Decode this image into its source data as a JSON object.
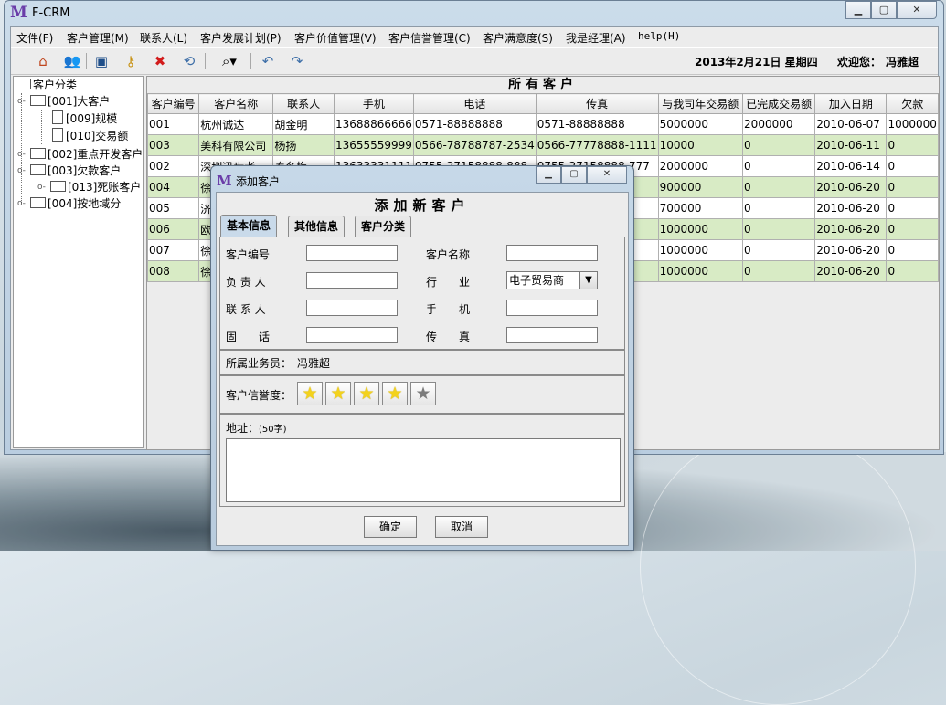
{
  "window": {
    "title": "F-CRM",
    "logo_letter": "M",
    "controls": {
      "minimize": "▁",
      "maximize": "▢",
      "close": "✕"
    }
  },
  "menu": [
    "文件(F)",
    "客户管理(M)",
    "联系人(L)",
    "客户发展计划(P)",
    "客户价值管理(V)",
    "客户信誉管理(C)",
    "客户满意度(S)",
    "我是经理(A)",
    "help(H)"
  ],
  "toolbar": {
    "icons": [
      "home-icon",
      "users-icon",
      "save-icon",
      "key-icon",
      "delete-icon",
      "refresh-icon",
      "binoculars-icon",
      "undo-icon",
      "redo-icon"
    ],
    "date": "2013年2月21日  星期四",
    "welcome_label": "欢迎您：",
    "user": "冯雅超"
  },
  "tree": {
    "root": "客户分类",
    "nodes": [
      {
        "label": "[001]大客户",
        "children": [
          "[009]规模",
          "[010]交易额"
        ]
      },
      {
        "label": "[002]重点开发客户",
        "children": []
      },
      {
        "label": "[003]欠款客户",
        "children": [
          "[013]死账客户"
        ]
      },
      {
        "label": "[004]按地域分",
        "children": []
      }
    ]
  },
  "customer_table": {
    "title": "所有客户",
    "columns": [
      "客户编号",
      "客户名称",
      "联系人",
      "手机",
      "电话",
      "传真",
      "与我司年交易额",
      "已完成交易额",
      "加入日期",
      "欠款"
    ],
    "rows": [
      [
        "001",
        "杭州诚达",
        "胡金明",
        "13688866666",
        "0571-88888888",
        "0571-88888888",
        "5000000",
        "2000000",
        "2010-06-07",
        "1000000"
      ],
      [
        "003",
        "美科有限公司",
        "杨扬",
        "13655559999",
        "0566-78788787-2534",
        "0566-77778888-1111",
        "10000",
        "0",
        "2010-06-11",
        "0"
      ],
      [
        "002",
        "深圳迅步者",
        "秦冬梅",
        "13633331111",
        "0755-27158888-888",
        "0755-27158888-777",
        "2000000",
        "0",
        "2010-06-14",
        "0"
      ],
      [
        "004",
        "徐",
        "",
        "",
        "",
        "",
        "900000",
        "0",
        "2010-06-20",
        "0"
      ],
      [
        "005",
        "济",
        "",
        "",
        "",
        "",
        "700000",
        "0",
        "2010-06-20",
        "0"
      ],
      [
        "006",
        "欧",
        "",
        "",
        "",
        "",
        "1000000",
        "0",
        "2010-06-20",
        "0"
      ],
      [
        "007",
        "徐",
        "",
        "",
        "",
        "",
        "1000000",
        "0",
        "2010-06-20",
        "0"
      ],
      [
        "008",
        "徐",
        "",
        "",
        "",
        "",
        "1000000",
        "0",
        "2010-06-20",
        "0"
      ]
    ]
  },
  "dialog": {
    "title": "添加客户",
    "heading": "添加新客户",
    "tabs": [
      "基本信息",
      "其他信息",
      "客户分类"
    ],
    "fields": {
      "customer_id": {
        "label": "客户编号",
        "value": ""
      },
      "customer_name": {
        "label": "客户名称",
        "value": ""
      },
      "manager": {
        "label": "负 责 人",
        "value": ""
      },
      "industry": {
        "label": "行　　业",
        "value": "电子贸易商"
      },
      "contact": {
        "label": "联 系 人",
        "value": ""
      },
      "mobile": {
        "label": "手　　机",
        "value": ""
      },
      "phone": {
        "label": "固　　话",
        "value": ""
      },
      "fax": {
        "label": "传　　真",
        "value": ""
      }
    },
    "salesman_label": "所属业务员：",
    "salesman": "冯雅超",
    "credit_label": "客户信誉度：",
    "credit_rating": 4,
    "credit_max": 5,
    "address_label": "地址：",
    "address_hint": "(50字)",
    "address_value": "",
    "ok_label": "确定",
    "cancel_label": "取消",
    "controls": {
      "minimize": "▁",
      "maximize": "▢",
      "close": "✕"
    }
  }
}
